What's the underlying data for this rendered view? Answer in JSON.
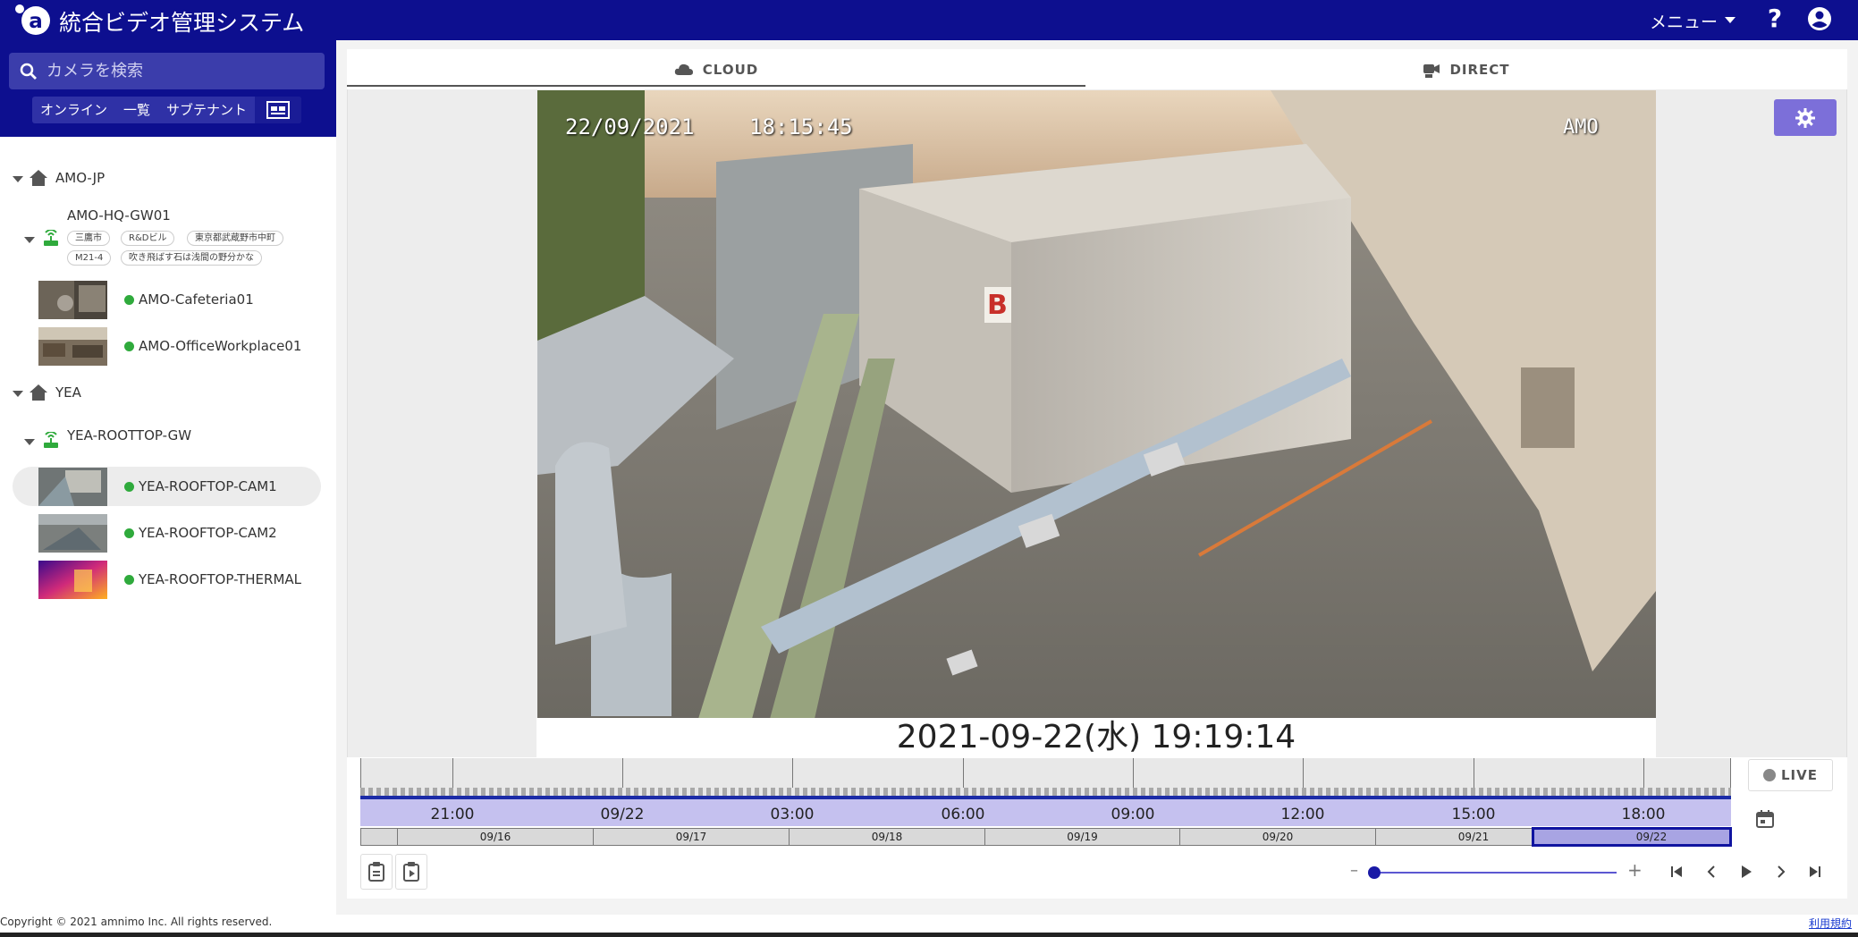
{
  "app": {
    "title": "統合ビデオ管理システム",
    "menu_label": "メニュー",
    "help_label": "?"
  },
  "sidebar": {
    "search_placeholder": "カメラを検索",
    "filter_tabs": [
      "オンライン",
      "一覧",
      "サブテナント"
    ],
    "tree": [
      {
        "site": "AMO-JP",
        "gateways": [
          {
            "name": "AMO-HQ-GW01",
            "tags": [
              "三鷹市",
              "R&Dビル",
              "東京都武蔵野市中町",
              "M21-4",
              "吹き飛ばす石は浅間の野分かな"
            ],
            "cameras": [
              {
                "name": "AMO-Cafeteria01",
                "status": "online"
              },
              {
                "name": "AMO-OfficeWorkplace01",
                "status": "online"
              }
            ]
          }
        ]
      },
      {
        "site": "YEA",
        "gateways": [
          {
            "name": "YEA-ROOTTOP-GW",
            "tags": [],
            "cameras": [
              {
                "name": "YEA-ROOFTOP-CAM1",
                "status": "online",
                "selected": true
              },
              {
                "name": "YEA-ROOFTOP-CAM2",
                "status": "online"
              },
              {
                "name": "YEA-ROOFTOP-THERMAL",
                "status": "online"
              }
            ]
          }
        ]
      }
    ]
  },
  "viewer": {
    "tabs": [
      {
        "label": "CLOUD",
        "icon": "cloud-icon",
        "active": true
      },
      {
        "label": "DIRECT",
        "icon": "camera-icon",
        "active": false
      }
    ],
    "osd": {
      "date": "22/09/2021",
      "time": "18:15:45",
      "label": "AMO"
    },
    "timestamp": "2021-09-22(水) 19:19:14"
  },
  "timeline": {
    "hour_labels": [
      "21:00",
      "09/22",
      "03:00",
      "06:00",
      "09:00",
      "12:00",
      "15:00",
      "18:00"
    ],
    "day_labels": [
      "09/16",
      "09/17",
      "09/18",
      "09/19",
      "09/20",
      "09/21",
      "09/22"
    ],
    "selected_day": "09/22",
    "live_label": "LIVE"
  },
  "colors": {
    "header": "#0d0f8f",
    "accent": "#7c6fd9",
    "online": "#2faa3c",
    "timeline_range": "#c5c1ef"
  },
  "footer": {
    "copyright": "Copyright © 2021 amnimo Inc. All rights reserved.",
    "terms": "利用規約"
  }
}
